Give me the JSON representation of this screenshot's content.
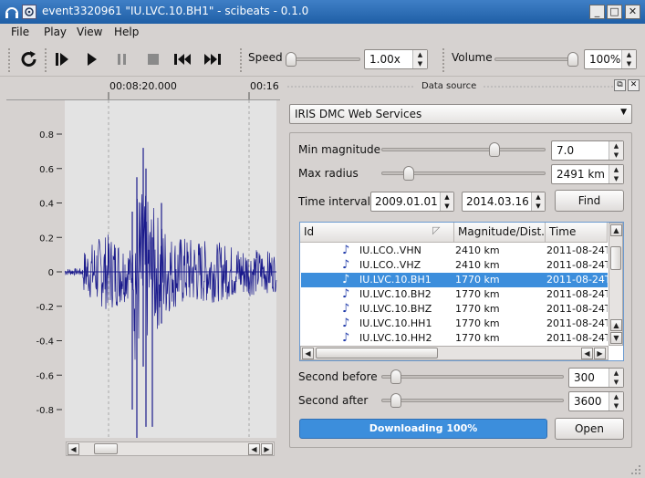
{
  "window": {
    "title": "event3320961 \"IU.LVC.10.BH1\" - scibeats - 0.1.0",
    "controls": [
      "_",
      "□",
      "✕"
    ]
  },
  "menu": [
    "File",
    "Play",
    "View",
    "Help"
  ],
  "toolbar": {
    "speed_label": "Speed",
    "speed_value": "1.00x",
    "speed_level": 0.0,
    "volume_label": "Volume",
    "volume_value": "100%",
    "volume_level": 1.0
  },
  "waveform": {
    "time_labels": [
      "00:08:20.000",
      "00:16"
    ],
    "y_ticks": [
      "0.8",
      "0.6",
      "0.4",
      "0.2",
      "0",
      "-0.2",
      "-0.4",
      "-0.6",
      "-0.8"
    ],
    "trace_color": "#1a1a8c",
    "background": "#e3e3e3"
  },
  "data_source": {
    "dock_title": "Data source",
    "provider": "IRIS DMC Web Services",
    "min_magnitude_label": "Min magnitude",
    "min_magnitude_value": "7.0",
    "min_magnitude_level": 0.7,
    "max_radius_label": "Max radius",
    "max_radius_value": "2491 km",
    "max_radius_level": 0.14,
    "time_interval_label": "Time interval",
    "date_from": "2009.01.01",
    "date_to": "2014.03.16",
    "find_label": "Find",
    "columns": [
      "Id",
      "Magnitude/Dist...",
      "Time"
    ],
    "rows": [
      {
        "id": "IU.LCO..VHN",
        "dist": "2410 km",
        "time": "2011-08-24T",
        "selected": false
      },
      {
        "id": "IU.LCO..VHZ",
        "dist": "2410 km",
        "time": "2011-08-24T",
        "selected": false
      },
      {
        "id": "IU.LVC.10.BH1",
        "dist": "1770 km",
        "time": "2011-08-24T",
        "selected": true
      },
      {
        "id": "IU.LVC.10.BH2",
        "dist": "1770 km",
        "time": "2011-08-24T",
        "selected": false
      },
      {
        "id": "IU.LVC.10.BHZ",
        "dist": "1770 km",
        "time": "2011-08-24T",
        "selected": false
      },
      {
        "id": "IU.LVC.10.HH1",
        "dist": "1770 km",
        "time": "2011-08-24T",
        "selected": false
      },
      {
        "id": "IU.LVC.10.HH2",
        "dist": "1770 km",
        "time": "2011-08-24T",
        "selected": false
      }
    ],
    "second_before_label": "Second before",
    "second_before_value": "300",
    "second_after_label": "Second after",
    "second_after_value": "3600",
    "progress_text": "Downloading 100%",
    "progress_percent": 100,
    "open_label": "Open"
  },
  "colors": {
    "accent": "#3c8edc",
    "titlebar": "#2f6fb5",
    "background": "#d6d2d0"
  }
}
